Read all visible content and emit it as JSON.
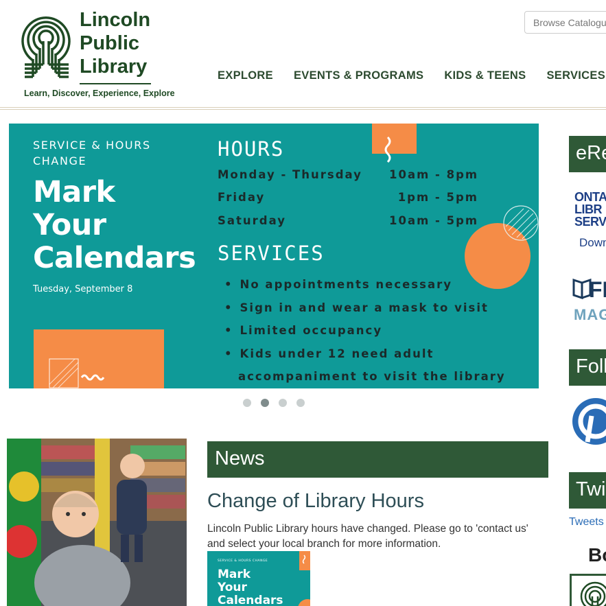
{
  "header": {
    "logo": {
      "line1": "Lincoln",
      "line2": "Public",
      "line3": "Library",
      "tagline": "Learn, Discover, Experience, Explore"
    },
    "search": {
      "placeholder": "Browse Catalogue"
    },
    "nav": [
      "EXPLORE",
      "EVENTS & PROGRAMS",
      "KIDS & TEENS",
      "SERVICES"
    ]
  },
  "carousel": {
    "slide": {
      "kicker_line1": "SERVICE & HOURS",
      "kicker_line2": "CHANGE",
      "title_line1": "Mark",
      "title_line2": "Your",
      "title_line3": "Calendars",
      "date": "Tuesday, September 8",
      "hours_heading": "HOURS",
      "hours": [
        {
          "day": "Monday - Thursday",
          "time": "10am - 8pm"
        },
        {
          "day": "Friday",
          "time": "1pm - 5pm"
        },
        {
          "day": "Saturday",
          "time": "10am - 5pm"
        }
      ],
      "services_heading": "SERVICES",
      "services": [
        "No appointments necessary",
        "Sign in and wear a mask to visit",
        "Limited occupancy",
        "Kids under 12 need adult",
        "accompaniment to visit the library"
      ]
    },
    "dots_count": 4,
    "active_dot": 2
  },
  "news": {
    "heading": "News",
    "article_title": "Change of Library Hours",
    "article_body": "Lincoln Public Library hours have changed. Please go to 'contact us' and select your local branch for more information.",
    "thumb": {
      "kicker": "SERVICE & HOURS CHANGE",
      "line1": "Mark",
      "line2": "Your",
      "line3": "Calendars"
    }
  },
  "sidebar": {
    "ereads_heading": "eRe",
    "ontario_line1": "ONTA",
    "ontario_line2": "LIBR",
    "ontario_line3": "SERV",
    "download": "Down",
    "flipster": "FI",
    "mag": "MAG",
    "follow_heading": "Foll",
    "twitter_heading": "Twi",
    "tweets_link": "Tweets",
    "b_heading": "Bo"
  },
  "colors": {
    "brand_green": "#2f5937",
    "logo_green": "#1f4a24",
    "teal": "#0f9a98",
    "orange": "#f58c47",
    "link_blue": "#2a6cb6"
  }
}
